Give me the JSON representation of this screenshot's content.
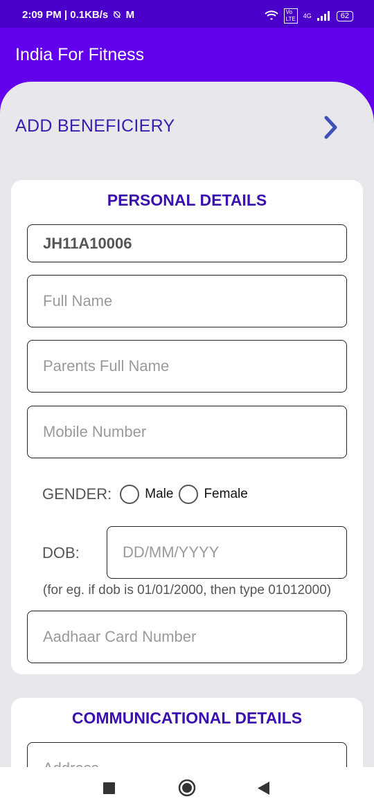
{
  "status_bar": {
    "time_speed": "2:09 PM | 0.1KB/s",
    "network": "4G",
    "battery": "62"
  },
  "app_bar": {
    "title": "India For Fitness"
  },
  "add_beneficiary": {
    "label": "ADD BENEFICIERY"
  },
  "personal_details": {
    "title": "PERSONAL DETAILS",
    "id_value": "JH11A10006",
    "full_name_placeholder": "Full Name",
    "parents_name_placeholder": "Parents Full Name",
    "mobile_placeholder": "Mobile Number",
    "gender_label": "GENDER:",
    "gender_options": [
      "Male",
      "Female"
    ],
    "dob_label": "DOB:",
    "dob_placeholder": "DD/MM/YYYY",
    "dob_hint": "(for eg. if dob is 01/01/2000, then type 01012000)",
    "aadhaar_placeholder": "Aadhaar Card Number"
  },
  "communication_details": {
    "title": "COMMUNICATIONAL DETAILS",
    "address_placeholder": "Address"
  },
  "colors": {
    "primary": "#6200ee",
    "status_bar": "#4a00c8",
    "section_title": "#3a10b0",
    "background": "#e8e8ec"
  },
  "icons": {
    "chevron": "chevron-right-icon",
    "recents": "recents-square-icon",
    "home": "home-circle-icon",
    "back": "back-triangle-icon"
  }
}
